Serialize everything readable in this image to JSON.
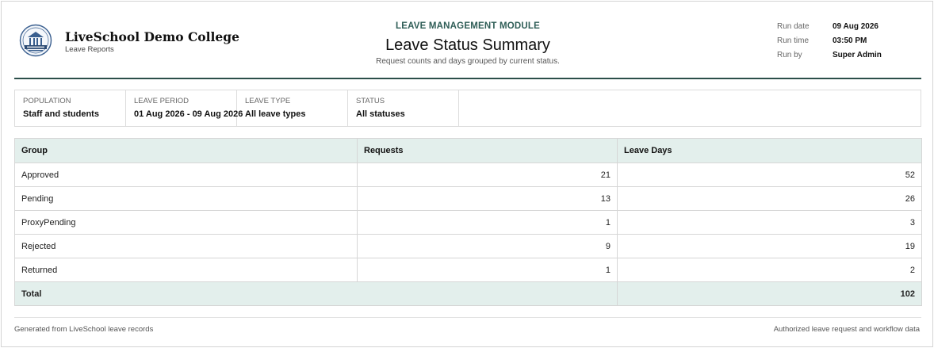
{
  "colors": {
    "accent": "#2f5e57",
    "header_rule": "#2c4f4a",
    "table_header_bg": "#e3efec",
    "border": "#d6d6d6"
  },
  "header": {
    "org_name": "LiveSchool Demo College",
    "org_sub": "Leave Reports",
    "logo_icon": "college-crest-icon",
    "module": "LEAVE MANAGEMENT MODULE",
    "title": "Leave Status Summary",
    "subtitle": "Request counts and days grouped by current status.",
    "meta": [
      {
        "label": "Run date",
        "value": "09 Aug 2026"
      },
      {
        "label": "Run time",
        "value": "03:50 PM"
      },
      {
        "label": "Run by",
        "value": "Super Admin"
      }
    ]
  },
  "filters": [
    {
      "label": "POPULATION",
      "value": "Staff and students"
    },
    {
      "label": "LEAVE PERIOD",
      "value": "01 Aug 2026 - 09 Aug 2026"
    },
    {
      "label": "LEAVE TYPE",
      "value": "All leave types"
    },
    {
      "label": "STATUS",
      "value": "All statuses"
    }
  ],
  "table": {
    "columns": [
      "Group",
      "Requests",
      "Leave Days"
    ],
    "rows": [
      {
        "group": "Approved",
        "requests": "21",
        "days": "52"
      },
      {
        "group": "Pending",
        "requests": "13",
        "days": "26"
      },
      {
        "group": "ProxyPending",
        "requests": "1",
        "days": "3"
      },
      {
        "group": "Rejected",
        "requests": "9",
        "days": "19"
      },
      {
        "group": "Returned",
        "requests": "1",
        "days": "2"
      }
    ],
    "total": {
      "label": "Total",
      "days": "102"
    }
  },
  "footer": {
    "left": "Generated from LiveSchool leave records",
    "right": "Authorized leave request and workflow data"
  }
}
